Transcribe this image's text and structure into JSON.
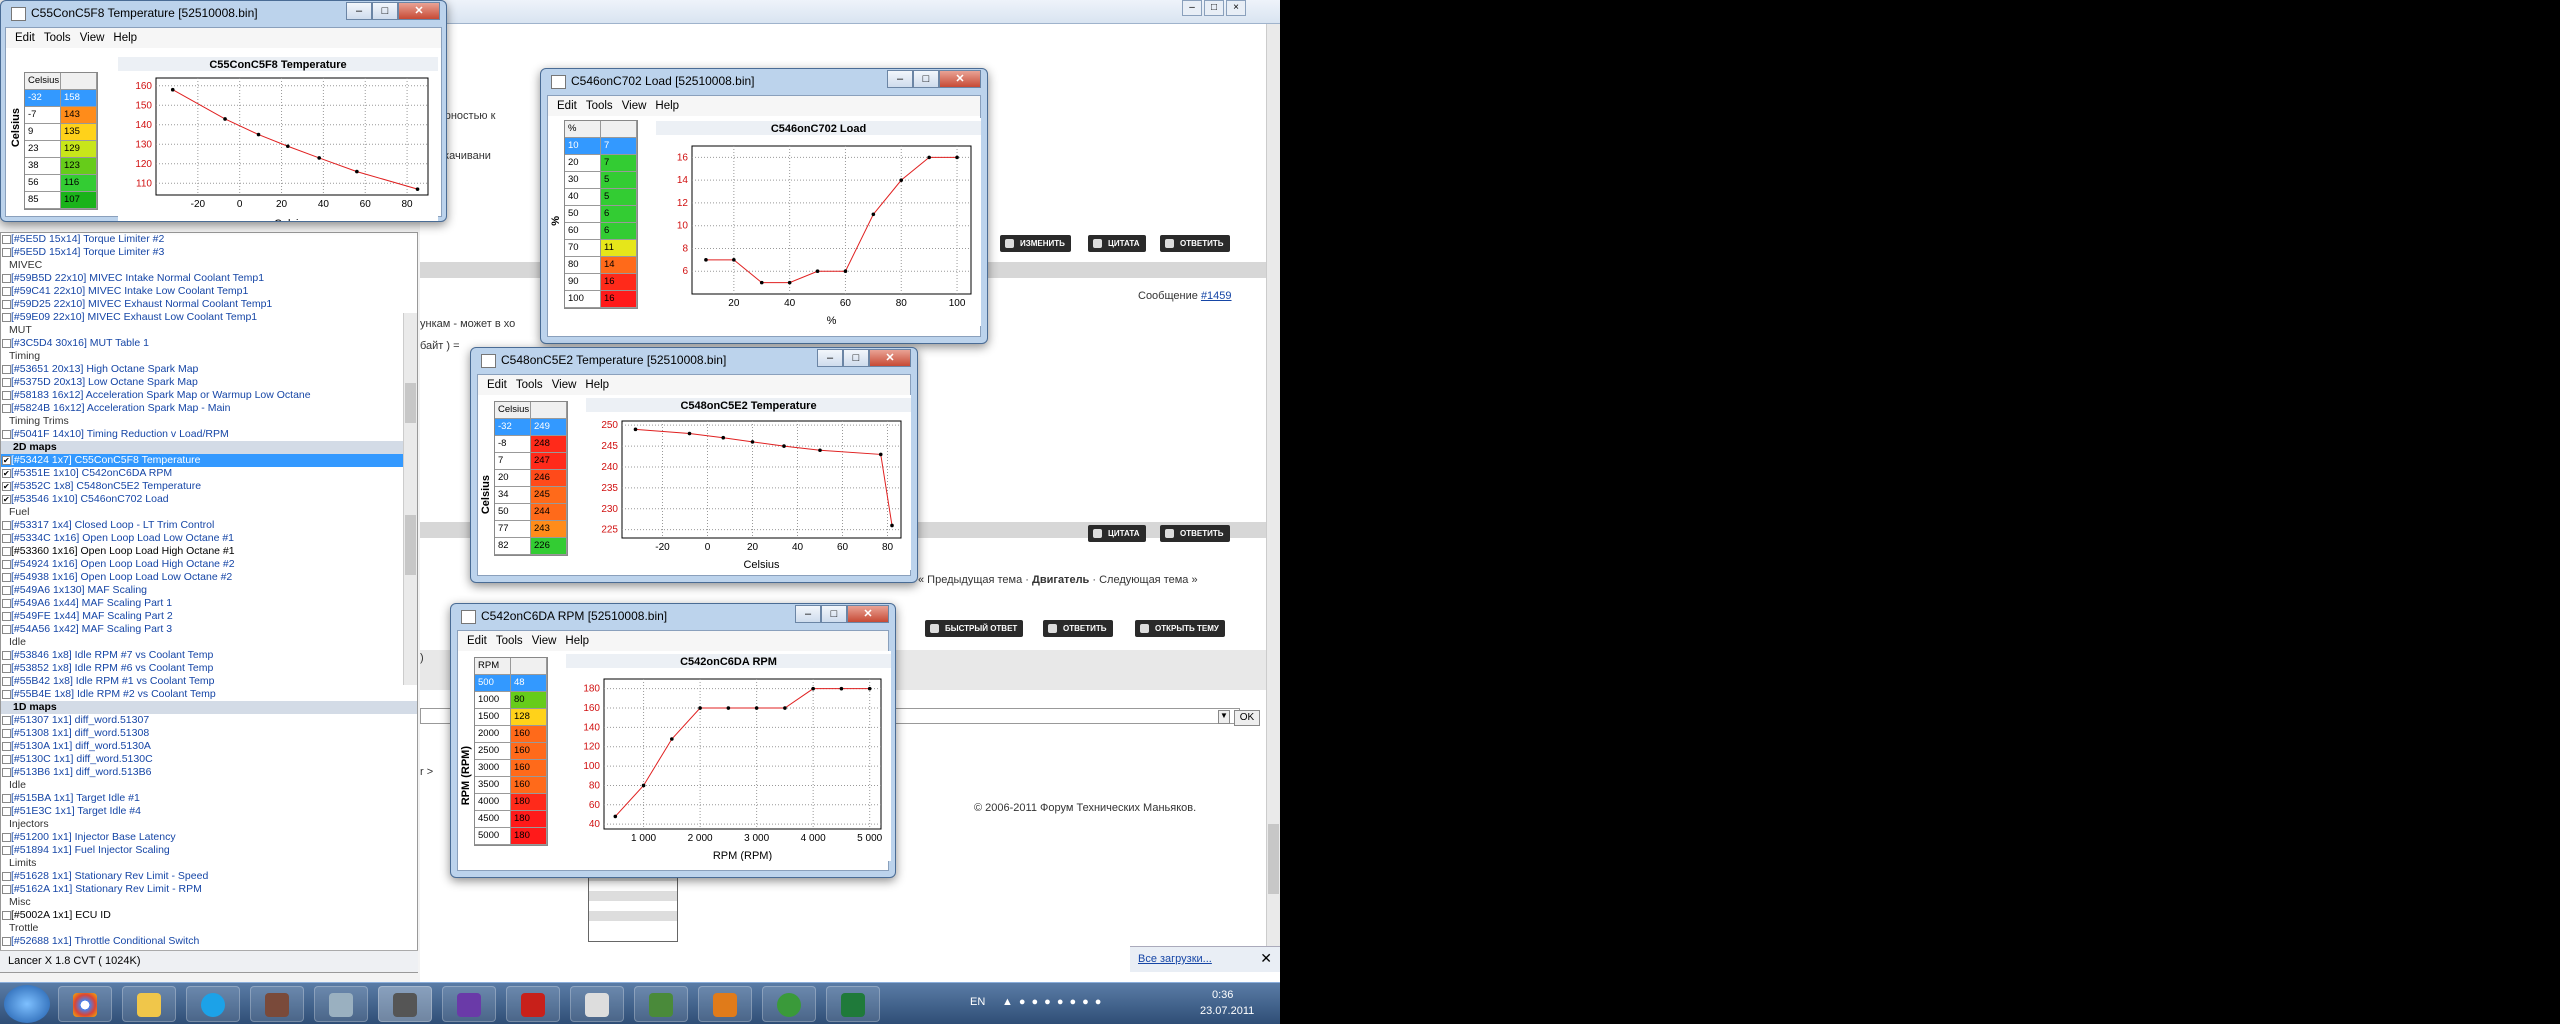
{
  "browser": {
    "right_text_1": "азмерностью к",
    "right_text_2": "-во скачивани",
    "right_text_3": "ункам - может в хо",
    "right_text_4": "байт ) =",
    "msg_label": "Сообщение",
    "msg_num": "#1459",
    "prev_topic": "« Предыдущая тема",
    "topic_name": "Двигатель",
    "next_topic": "Следующая тема »",
    "copyright": "© 2006-2011  Форум Технических Маньяков.",
    "btn_edit": "ИЗМЕНИТЬ",
    "btn_quote": "ЦИТАТА",
    "btn_reply": "ОТВЕТИТЬ",
    "btn_quick": "БЫСТРЫЙ ОТВЕТ",
    "btn_reply2": "ОТВЕТИТЬ",
    "btn_newtopic": "ОТКРЫТЬ ТЕМУ",
    "ok": "OK",
    "dl_text": "Все загрузки...",
    "path_frag": "r >",
    "paren": ")"
  },
  "tree": {
    "rows": [
      {
        "t": "[#5E5D 15x14] Torque Limiter #2",
        "k": "i"
      },
      {
        "t": "[#5E5D 15x14] Torque Limiter #3",
        "k": "i"
      },
      {
        "t": "MIVEC",
        "k": "c"
      },
      {
        "t": "[#59B5D 22x10] MIVEC Intake Normal Coolant Temp1",
        "k": "i"
      },
      {
        "t": "[#59C41 22x10] MIVEC Intake Low Coolant Temp1",
        "k": "i"
      },
      {
        "t": "[#59D25 22x10] MIVEC Exhaust Normal Coolant Temp1",
        "k": "i"
      },
      {
        "t": "[#59E09 22x10] MIVEC Exhaust Low Coolant Temp1",
        "k": "i"
      },
      {
        "t": "MUT",
        "k": "c"
      },
      {
        "t": "[#3C5D4 30x16] MUT Table 1",
        "k": "i"
      },
      {
        "t": "Timing",
        "k": "c"
      },
      {
        "t": "[#53651 20x13] High Octane Spark Map",
        "k": "i"
      },
      {
        "t": "[#5375D 20x13] Low Octane Spark Map",
        "k": "i"
      },
      {
        "t": "[#58183 16x12] Acceleration Spark Map or Warmup Low Octane",
        "k": "i"
      },
      {
        "t": "[#5824B 16x12] Acceleration Spark Map - Main",
        "k": "i"
      },
      {
        "t": "Timing Trims",
        "k": "c"
      },
      {
        "t": "[#5041F 14x10] Timing Reduction v Load/RPM",
        "k": "i"
      },
      {
        "t": "2D maps",
        "k": "h"
      },
      {
        "t": "[#53424 1x7] C55ConC5F8 Temperature",
        "k": "s"
      },
      {
        "t": "[#5351E 1x10] C542onC6DA RPM",
        "k": "on"
      },
      {
        "t": "[#5352C 1x8] C548onC5E2 Temperature",
        "k": "on"
      },
      {
        "t": "[#53546 1x10] C546onC702 Load",
        "k": "on"
      },
      {
        "t": "Fuel",
        "k": "c"
      },
      {
        "t": "[#53317 1x4] Closed Loop - LT Trim Control",
        "k": "i"
      },
      {
        "t": "[#5334C 1x16] Open Loop Load Low Octane #1",
        "k": "i"
      },
      {
        "t": "[#53360 1x16] Open Loop Load High Octane #1",
        "k": "b"
      },
      {
        "t": "[#54924 1x16] Open Loop Load High Octane #2",
        "k": "i"
      },
      {
        "t": "[#54938 1x16] Open Loop Load Low Octane #2",
        "k": "i"
      },
      {
        "t": "[#549A6 1x130] MAF Scaling",
        "k": "i"
      },
      {
        "t": "[#549A6 1x44] MAF Scaling Part 1",
        "k": "i"
      },
      {
        "t": "[#549FE 1x44] MAF Scaling Part 2",
        "k": "i"
      },
      {
        "t": "[#54A56 1x42] MAF Scaling Part 3",
        "k": "i"
      },
      {
        "t": "Idle",
        "k": "c"
      },
      {
        "t": "[#53846 1x8] Idle RPM #7 vs Coolant Temp",
        "k": "i"
      },
      {
        "t": "[#53852 1x8] Idle RPM #6 vs Coolant Temp",
        "k": "i"
      },
      {
        "t": "[#55B42 1x8] Idle RPM #1 vs Coolant Temp",
        "k": "i"
      },
      {
        "t": "[#55B4E 1x8] Idle RPM #2 vs Coolant Temp",
        "k": "i"
      },
      {
        "t": "1D maps",
        "k": "h"
      },
      {
        "t": "[#51307 1x1] diff_word.51307",
        "k": "i"
      },
      {
        "t": "[#51308 1x1] diff_word.51308",
        "k": "i"
      },
      {
        "t": "[#5130A 1x1] diff_word.5130A",
        "k": "i"
      },
      {
        "t": "[#5130C 1x1] diff_word.5130C",
        "k": "i"
      },
      {
        "t": "[#513B6 1x1] diff_word.513B6",
        "k": "i"
      },
      {
        "t": "Idle",
        "k": "c"
      },
      {
        "t": "[#515BA 1x1] Target Idle #1",
        "k": "i"
      },
      {
        "t": "[#51E3C 1x1] Target Idle #4",
        "k": "i"
      },
      {
        "t": "Injectors",
        "k": "c"
      },
      {
        "t": "[#51200 1x1] Injector Base Latency",
        "k": "i"
      },
      {
        "t": "[#51894 1x1] Fuel Injector Scaling",
        "k": "i"
      },
      {
        "t": "Limits",
        "k": "c"
      },
      {
        "t": "[#51628 1x1] Stationary Rev Limit - Speed",
        "k": "i"
      },
      {
        "t": "[#5162A 1x1] Stationary Rev Limit - RPM",
        "k": "i"
      },
      {
        "t": "Misc",
        "k": "c"
      },
      {
        "t": "[#5002A 1x1] ECU ID",
        "k": "b"
      },
      {
        "t": "Trottle",
        "k": "c"
      },
      {
        "t": "[#52688 1x1] Throttle Conditional Switch",
        "k": "i"
      }
    ],
    "status": "Lancer X 1.8 CVT ( 1024K)"
  },
  "menu": {
    "edit": "Edit",
    "tools": "Tools",
    "view": "View",
    "help": "Help"
  },
  "windows": {
    "w1": {
      "title": "C55ConC5F8 Temperature [52510008.bin]",
      "col": "Celsius",
      "vlabel": "Celsius",
      "rows": [
        [
          "-32",
          "158",
          "#3399ff"
        ],
        [
          "-7",
          "143",
          "#ff8c1a"
        ],
        [
          "9",
          "135",
          "#ffd21a"
        ],
        [
          "23",
          "129",
          "#c8e61a"
        ],
        [
          "38",
          "123",
          "#66cc1a"
        ],
        [
          "56",
          "116",
          "#33cc33"
        ],
        [
          "85",
          "107",
          "#1ab31a"
        ]
      ]
    },
    "w2": {
      "title": "C546onC702 Load [52510008.bin]",
      "col": "%",
      "vlabel": "%",
      "rows": [
        [
          "10",
          "7",
          "#3399ff"
        ],
        [
          "20",
          "7",
          "#33cc33"
        ],
        [
          "30",
          "5",
          "#33cc33"
        ],
        [
          "40",
          "5",
          "#33cc33"
        ],
        [
          "50",
          "6",
          "#33cc33"
        ],
        [
          "60",
          "6",
          "#33cc33"
        ],
        [
          "70",
          "11",
          "#e6e61a"
        ],
        [
          "80",
          "14",
          "#ff6a1a"
        ],
        [
          "90",
          "16",
          "#ff2a1a"
        ],
        [
          "100",
          "16",
          "#ff1a1a"
        ]
      ]
    },
    "w3": {
      "title": "C548onC5E2 Temperature [52510008.bin]",
      "col": "Celsius",
      "vlabel": "Celsius",
      "rows": [
        [
          "-32",
          "249",
          "#3399ff"
        ],
        [
          "-8",
          "248",
          "#ff2a1a"
        ],
        [
          "7",
          "247",
          "#ff2a1a"
        ],
        [
          "20",
          "246",
          "#ff4a1a"
        ],
        [
          "34",
          "245",
          "#ff6a1a"
        ],
        [
          "50",
          "244",
          "#ff6a1a"
        ],
        [
          "77",
          "243",
          "#ff8c1a"
        ],
        [
          "82",
          "226",
          "#33cc33"
        ]
      ]
    },
    "w4": {
      "title": "C542onC6DA RPM [52510008.bin]",
      "col": "RPM",
      "vlabel": "RPM (RPM)",
      "rows": [
        [
          "500",
          "48",
          "#3399ff"
        ],
        [
          "1000",
          "80",
          "#66cc1a"
        ],
        [
          "1500",
          "128",
          "#ffd21a"
        ],
        [
          "2000",
          "160",
          "#ff6a1a"
        ],
        [
          "2500",
          "160",
          "#ff6a1a"
        ],
        [
          "3000",
          "160",
          "#ff6a1a"
        ],
        [
          "3500",
          "160",
          "#ff6a1a"
        ],
        [
          "4000",
          "180",
          "#ff2a1a"
        ],
        [
          "4500",
          "180",
          "#ff1a1a"
        ],
        [
          "5000",
          "180",
          "#ff1a1a"
        ]
      ]
    }
  },
  "chart_data": [
    {
      "type": "line",
      "title": "C55ConC5F8 Temperature",
      "xlabel": "Celsius",
      "ylabel": "",
      "x": [
        -32,
        -7,
        9,
        23,
        38,
        56,
        85
      ],
      "y": [
        158,
        143,
        135,
        129,
        123,
        116,
        107
      ],
      "xlim": [
        -40,
        90
      ],
      "ylim": [
        104,
        164
      ],
      "xticks": [
        -20,
        0,
        20,
        40,
        60,
        80
      ],
      "yticks": [
        110,
        120,
        130,
        140,
        150,
        160
      ],
      "grid": true
    },
    {
      "type": "line",
      "title": "C546onC702 Load",
      "xlabel": "%",
      "ylabel": "",
      "x": [
        10,
        20,
        30,
        40,
        50,
        60,
        70,
        80,
        90,
        100
      ],
      "y": [
        7,
        7,
        5,
        5,
        6,
        6,
        11,
        14,
        16,
        16
      ],
      "xlim": [
        5,
        105
      ],
      "ylim": [
        4,
        17
      ],
      "xticks": [
        20,
        40,
        60,
        80,
        100
      ],
      "yticks": [
        6,
        8,
        10,
        12,
        14,
        16
      ],
      "grid": true
    },
    {
      "type": "line",
      "title": "C548onC5E2 Temperature",
      "xlabel": "Celsius",
      "ylabel": "",
      "x": [
        -32,
        -8,
        7,
        20,
        34,
        50,
        77,
        82
      ],
      "y": [
        249,
        248,
        247,
        246,
        245,
        244,
        243,
        226
      ],
      "xlim": [
        -38,
        86
      ],
      "ylim": [
        223,
        251
      ],
      "xticks": [
        -20,
        0,
        20,
        40,
        60,
        80
      ],
      "yticks": [
        225,
        230,
        235,
        240,
        245,
        250
      ],
      "grid": true
    },
    {
      "type": "line",
      "title": "C542onC6DA RPM",
      "xlabel": "RPM (RPM)",
      "ylabel": "",
      "x": [
        500,
        1000,
        1500,
        2000,
        2500,
        3000,
        3500,
        4000,
        4500,
        5000
      ],
      "y": [
        48,
        80,
        128,
        160,
        160,
        160,
        160,
        180,
        180,
        180
      ],
      "xlim": [
        300,
        5200
      ],
      "ylim": [
        35,
        190
      ],
      "xticks": [
        1000,
        2000,
        3000,
        4000,
        5000
      ],
      "xticklabels": [
        "1 000",
        "2 000",
        "3 000",
        "4 000",
        "5 000"
      ],
      "yticks": [
        40,
        60,
        80,
        100,
        120,
        140,
        160,
        180
      ],
      "grid": true
    }
  ],
  "taskbar": {
    "lang": "EN",
    "time": "0:36",
    "date": "23.07.2011"
  },
  "colors": {
    "line": "#e02020",
    "accent": "#3399ff"
  }
}
